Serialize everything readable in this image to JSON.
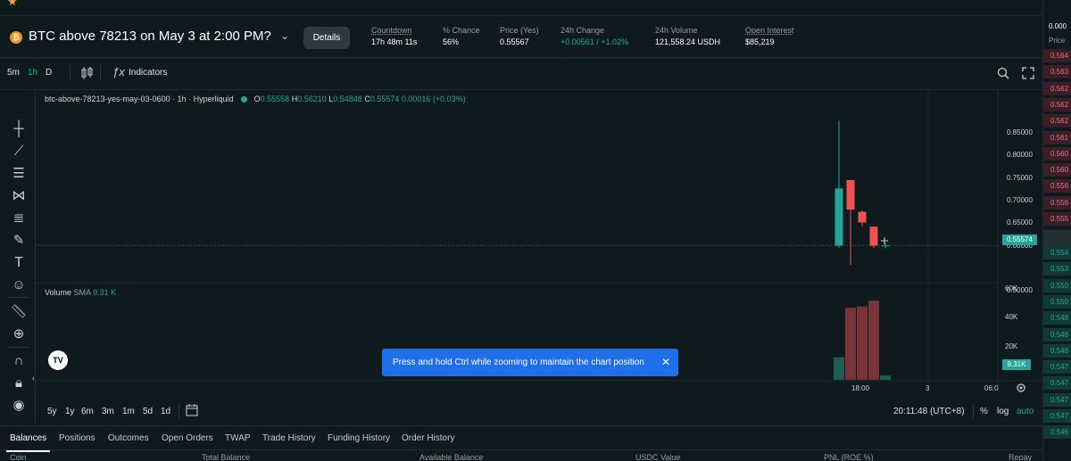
{
  "market": {
    "title": "BTC above 78213 on May 3 at 2:00 PM?",
    "coin_icon": "bitcoin-icon",
    "details_label": "Details",
    "stats": [
      {
        "label": "Countdown",
        "value": "17h 48m 11s"
      },
      {
        "label": "% Chance",
        "value": "56%"
      },
      {
        "label": "Price (Yes)",
        "value": "0.55567"
      },
      {
        "label": "24h Change",
        "value": "+0.00561 / +1.02%"
      },
      {
        "label": "24h Volume",
        "value": "121,558.24 USDH"
      },
      {
        "label": "Open Interest",
        "value": "$85,219"
      }
    ]
  },
  "toolbar": {
    "intervals": [
      "5m",
      "1h",
      "D"
    ],
    "active_interval": "1h",
    "indicators_label": "Indicators"
  },
  "chart": {
    "symbol": "btc-above-78213-yes-may-03-0600 · 1h · Hyperliquid",
    "ohlc": {
      "o_label": "O",
      "o": "0.55558",
      "h_label": "H",
      "h": "0.56210",
      "l_label": "L",
      "l": "0.54848",
      "c_label": "C",
      "c": "0.55574",
      "change": "0.00016 (+0.03%)"
    },
    "current_price": "0.55574",
    "volume_label": "Volume",
    "volume_sma_label": "SMA",
    "volume_sma": "9.31 K",
    "volume_tag": "9.31K",
    "time_labels": [
      "18:00",
      "3",
      "06:0"
    ],
    "timezone": "20:11:48 (UTC+8)",
    "scale_options": [
      "%",
      "log",
      "auto"
    ],
    "colors": {
      "up": "#26a69a",
      "down": "#ef5350",
      "background": "#0f1a1f"
    }
  },
  "chart_data": {
    "type": "candlestick",
    "price_ticks": [
      "0.85000",
      "0.80000",
      "0.75000",
      "0.70000",
      "0.65000",
      "0.60000",
      "0.50000"
    ],
    "ylim": [
      0.47,
      0.88
    ],
    "volume_ticks": [
      "60K",
      "40K",
      "20K"
    ],
    "volume_ylim": [
      0,
      65000
    ],
    "candles": [
      {
        "o": 0.555,
        "h": 0.85,
        "l": 0.55,
        "c": 0.69,
        "v": 16000
      },
      {
        "o": 0.71,
        "h": 0.71,
        "l": 0.51,
        "c": 0.64,
        "v": 51000
      },
      {
        "o": 0.635,
        "h": 0.638,
        "l": 0.6,
        "c": 0.61,
        "v": 52000
      },
      {
        "o": 0.6,
        "h": 0.6,
        "l": 0.55,
        "c": 0.555,
        "v": 56000
      },
      {
        "o": 0.55558,
        "h": 0.5621,
        "l": 0.54848,
        "c": 0.55574,
        "v": 3000
      }
    ]
  },
  "range_buttons": [
    "5y",
    "1y",
    "6m",
    "3m",
    "1m",
    "5d",
    "1d"
  ],
  "toast": {
    "message": "Press and hold Ctrl while zooming to maintain the chart position"
  },
  "bottom_tabs": [
    "Balances",
    "Positions",
    "Outcomes",
    "Open Orders",
    "TWAP",
    "Trade History",
    "Funding History",
    "Order History"
  ],
  "balances_columns": [
    "Coin",
    "Total Balance",
    "Available Balance",
    "USDC Value",
    "PNL (ROE %)",
    "Repay"
  ],
  "order_book": {
    "header_value": "0.000",
    "header_label": "Price",
    "asks": [
      "0.564",
      "0.563",
      "0.562",
      "0.562",
      "0.562",
      "0.561",
      "0.560",
      "0.560",
      "0.556",
      "0.556",
      "0.555"
    ],
    "bids": [
      "0.554",
      "0.553",
      "0.550",
      "0.550",
      "0.548",
      "0.548",
      "0.548",
      "0.547",
      "0.547",
      "0.547",
      "0.547",
      "0.546"
    ]
  }
}
